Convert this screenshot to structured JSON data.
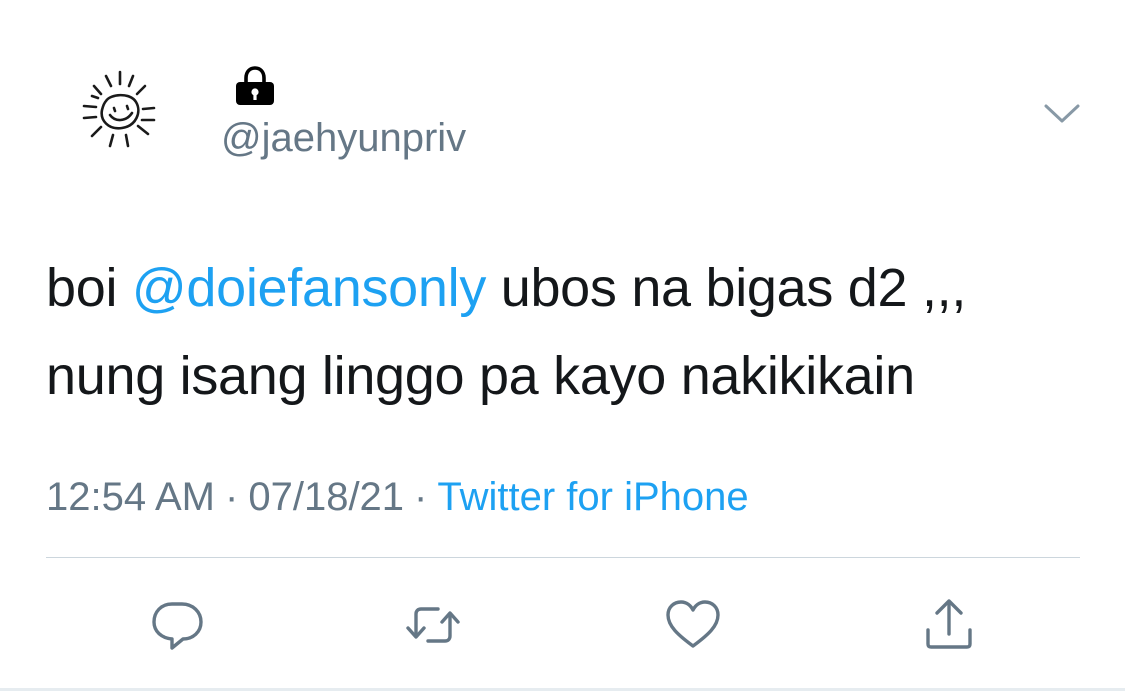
{
  "author": {
    "handle": "@jaehyunpriv",
    "avatar_icon": "smiling-sun-drawing",
    "protected_icon": "lock-icon"
  },
  "tweet": {
    "text_prefix": "boi ",
    "mention": "@doiefansonly",
    "text_suffix": " ubos na bigas d2 ,,, nung isang linggo pa kayo nakikikain"
  },
  "meta": {
    "time": "12:54 AM",
    "date": "07/18/21",
    "separator": "·",
    "source": "Twitter for iPhone"
  },
  "actions": {
    "reply_icon": "reply-icon",
    "retweet_icon": "retweet-icon",
    "like_icon": "heart-icon",
    "share_icon": "share-icon"
  },
  "colors": {
    "link": "#1da1f2",
    "secondary_text": "#657786",
    "primary_text": "#14171a",
    "divider": "#ccd6dd"
  }
}
